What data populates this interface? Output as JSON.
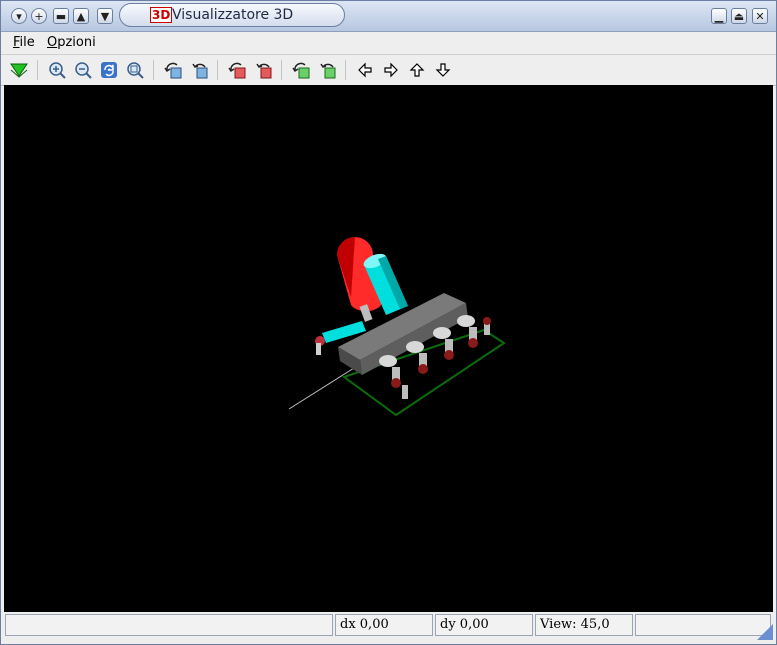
{
  "window": {
    "title": "Visualizzatore 3D",
    "logo_text": "3D",
    "title_buttons": [
      "menu-icon",
      "plus-icon",
      "minimize-icon",
      "shade-up-icon",
      "shade-down-icon"
    ],
    "right_buttons": [
      "minimize-icon",
      "maximize-icon",
      "close-icon"
    ]
  },
  "menu": {
    "items": [
      {
        "label": "File",
        "mnemonic": "F"
      },
      {
        "label": "Opzioni",
        "mnemonic": "O"
      }
    ]
  },
  "toolbar": {
    "tools": [
      "load-icon",
      "zoom-in-icon",
      "zoom-out-icon",
      "redraw-icon",
      "zoom-fit-icon",
      "rotate-x-ccw-icon",
      "rotate-x-cw-icon",
      "rotate-y-ccw-icon",
      "rotate-y-cw-icon",
      "rotate-z-ccw-icon",
      "rotate-z-cw-icon",
      "pan-left-icon",
      "pan-right-icon",
      "pan-up-icon",
      "pan-down-icon"
    ]
  },
  "viewport": {
    "background": "#000000",
    "scene": "3D PCB view with IC, LED, capacitor and resistor"
  },
  "status": {
    "field1": "",
    "dx": "dx 0,00",
    "dy": "dy 0,00",
    "view": "View: 45,0",
    "field5": ""
  },
  "colors": {
    "accent": "#6b7fa3",
    "led": "#ff2020",
    "capacitor": "#00e5e5",
    "ic_body": "#5a5a5a",
    "board_outline": "#0b6b0b"
  }
}
